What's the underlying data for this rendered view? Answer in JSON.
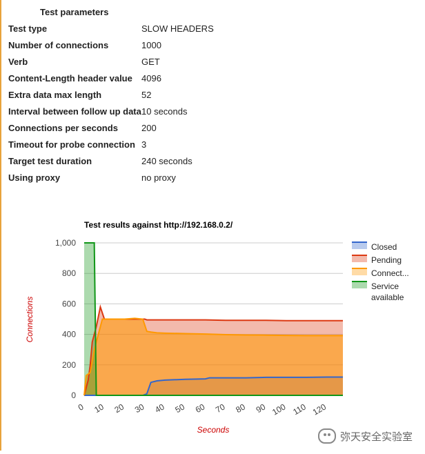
{
  "params": {
    "title": "Test parameters",
    "rows": [
      {
        "label": "Test type",
        "value": "SLOW HEADERS"
      },
      {
        "label": "Number of connections",
        "value": "1000"
      },
      {
        "label": "Verb",
        "value": "GET"
      },
      {
        "label": "Content-Length header value",
        "value": "4096"
      },
      {
        "label": "Extra data max length",
        "value": "52"
      },
      {
        "label": "Interval between follow up data",
        "value": "10 seconds"
      },
      {
        "label": "Connections per seconds",
        "value": "200"
      },
      {
        "label": "Timeout for probe connection",
        "value": "3"
      },
      {
        "label": "Target test duration",
        "value": "240 seconds"
      },
      {
        "label": "Using proxy",
        "value": "no proxy"
      }
    ]
  },
  "watermark": "弥天安全实验室",
  "chart_data": {
    "type": "area",
    "title": "Test results against http://192.168.0.2/",
    "xlabel": "Seconds",
    "ylabel": "Connections",
    "xlim": [
      0,
      128
    ],
    "ylim": [
      0,
      1000
    ],
    "x_ticks": [
      0,
      10,
      20,
      30,
      40,
      50,
      60,
      70,
      80,
      90,
      100,
      110,
      120
    ],
    "y_ticks": [
      0,
      200,
      400,
      600,
      800,
      1000
    ],
    "y_tick_labels": [
      "0",
      "200",
      "400",
      "600",
      "800",
      "1,000"
    ],
    "grid": true,
    "legend_position": "right",
    "series": [
      {
        "name": "Closed",
        "color": "#3366cc",
        "points": [
          [
            0,
            0
          ],
          [
            10,
            0
          ],
          [
            20,
            0
          ],
          [
            29,
            0
          ],
          [
            31,
            10
          ],
          [
            33,
            85
          ],
          [
            36,
            95
          ],
          [
            40,
            100
          ],
          [
            50,
            105
          ],
          [
            60,
            108
          ],
          [
            62,
            115
          ],
          [
            70,
            115
          ],
          [
            80,
            115
          ],
          [
            90,
            118
          ],
          [
            100,
            118
          ],
          [
            110,
            118
          ],
          [
            120,
            120
          ],
          [
            128,
            120
          ]
        ]
      },
      {
        "name": "Pending",
        "color": "#dc3912",
        "points": [
          [
            0,
            0
          ],
          [
            2,
            100
          ],
          [
            3,
            200
          ],
          [
            4,
            350
          ],
          [
            6,
            450
          ],
          [
            8,
            580
          ],
          [
            10,
            500
          ],
          [
            20,
            500
          ],
          [
            30,
            500
          ],
          [
            31,
            495
          ],
          [
            33,
            495
          ],
          [
            40,
            495
          ],
          [
            50,
            495
          ],
          [
            60,
            495
          ],
          [
            70,
            492
          ],
          [
            80,
            492
          ],
          [
            90,
            492
          ],
          [
            100,
            490
          ],
          [
            110,
            490
          ],
          [
            120,
            490
          ],
          [
            128,
            490
          ]
        ]
      },
      {
        "name": "Connect...",
        "color": "#ff9900",
        "points": [
          [
            0,
            0
          ],
          [
            1,
            130
          ],
          [
            3,
            150
          ],
          [
            5,
            300
          ],
          [
            7,
            400
          ],
          [
            9,
            500
          ],
          [
            15,
            500
          ],
          [
            20,
            500
          ],
          [
            25,
            505
          ],
          [
            29,
            500
          ],
          [
            31,
            420
          ],
          [
            33,
            415
          ],
          [
            36,
            410
          ],
          [
            40,
            408
          ],
          [
            50,
            405
          ],
          [
            60,
            402
          ],
          [
            70,
            398
          ],
          [
            80,
            396
          ],
          [
            90,
            395
          ],
          [
            100,
            393
          ],
          [
            110,
            392
          ],
          [
            120,
            392
          ],
          [
            128,
            392
          ]
        ]
      },
      {
        "name": "Service available",
        "color": "#109618",
        "points": [
          [
            0,
            1000
          ],
          [
            5,
            1000
          ],
          [
            6,
            0
          ],
          [
            128,
            0
          ]
        ]
      }
    ]
  }
}
